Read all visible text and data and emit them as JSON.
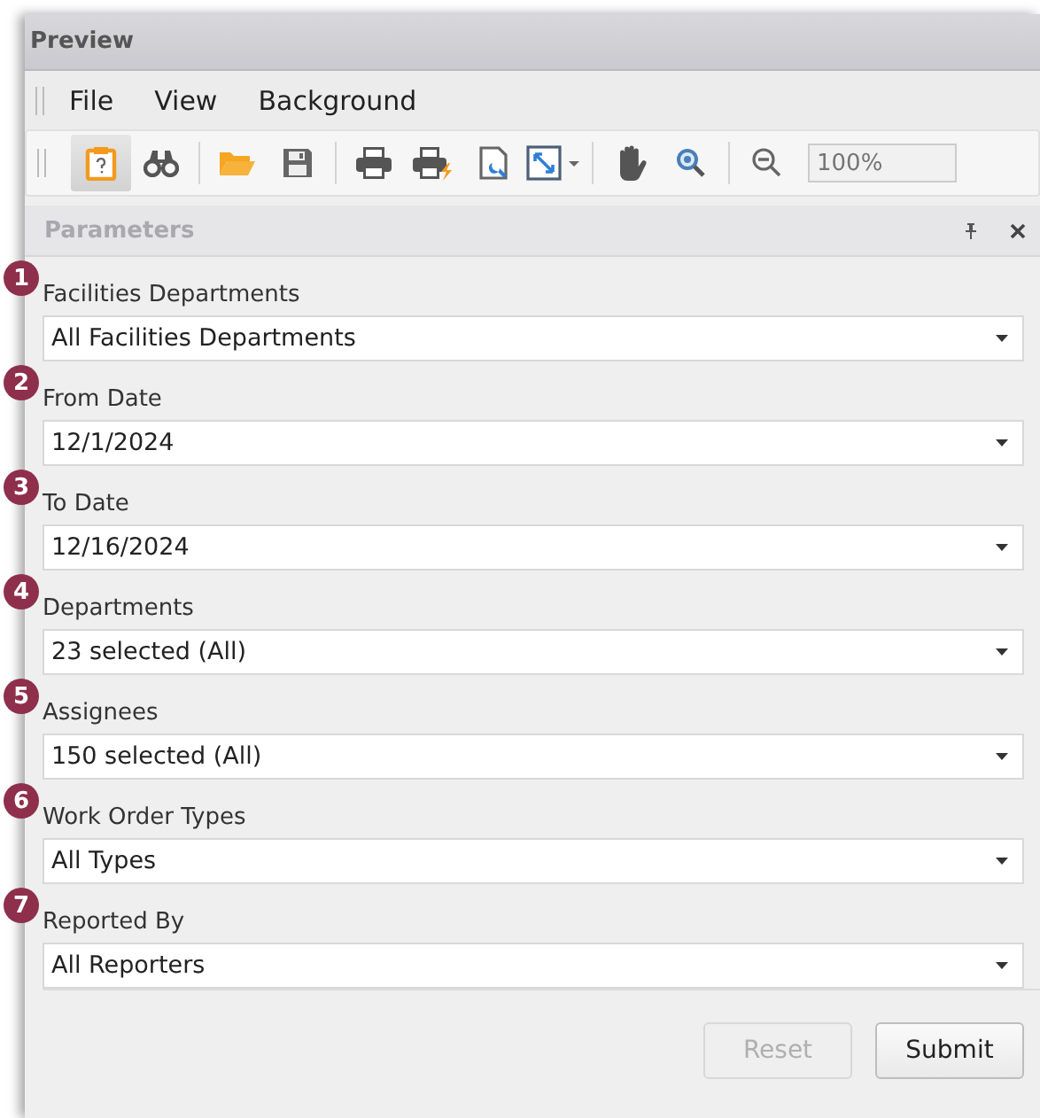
{
  "window": {
    "title": "Preview"
  },
  "menu": [
    {
      "label": "File"
    },
    {
      "label": "View"
    },
    {
      "label": "Background"
    }
  ],
  "toolbar": [
    {
      "kind": "parameters",
      "selected": true
    },
    {
      "kind": "find",
      "selected": false
    },
    {
      "kind": "separator"
    },
    {
      "kind": "open",
      "selected": false
    },
    {
      "kind": "save",
      "selected": false
    },
    {
      "kind": "separator"
    },
    {
      "kind": "print",
      "selected": false
    },
    {
      "kind": "quickprint",
      "selected": false
    },
    {
      "kind": "pagesetup",
      "selected": false
    },
    {
      "kind": "scale",
      "selected": false
    },
    {
      "kind": "separator"
    },
    {
      "kind": "hand",
      "selected": false
    },
    {
      "kind": "magnifier",
      "selected": false
    },
    {
      "kind": "separator"
    },
    {
      "kind": "zoomout",
      "selected": false
    },
    {
      "kind": "zoomfield",
      "placeholder": "100%"
    }
  ],
  "panel": {
    "title": "Parameters"
  },
  "parameters": [
    {
      "badge": "1",
      "label": "Facilities Departments",
      "value": "All Facilities Departments"
    },
    {
      "badge": "2",
      "label": "From Date",
      "value": "12/1/2024"
    },
    {
      "badge": "3",
      "label": "To Date",
      "value": "12/16/2024"
    },
    {
      "badge": "4",
      "label": "Departments",
      "value": "23 selected (All)"
    },
    {
      "badge": "5",
      "label": "Assignees",
      "value": "150 selected (All)"
    },
    {
      "badge": "6",
      "label": "Work Order Types",
      "value": "All Types"
    },
    {
      "badge": "7",
      "label": "Reported By",
      "value": "All Reporters"
    }
  ],
  "buttons": [
    {
      "label": "Reset",
      "disabled": true
    },
    {
      "label": "Submit",
      "disabled": false
    }
  ]
}
